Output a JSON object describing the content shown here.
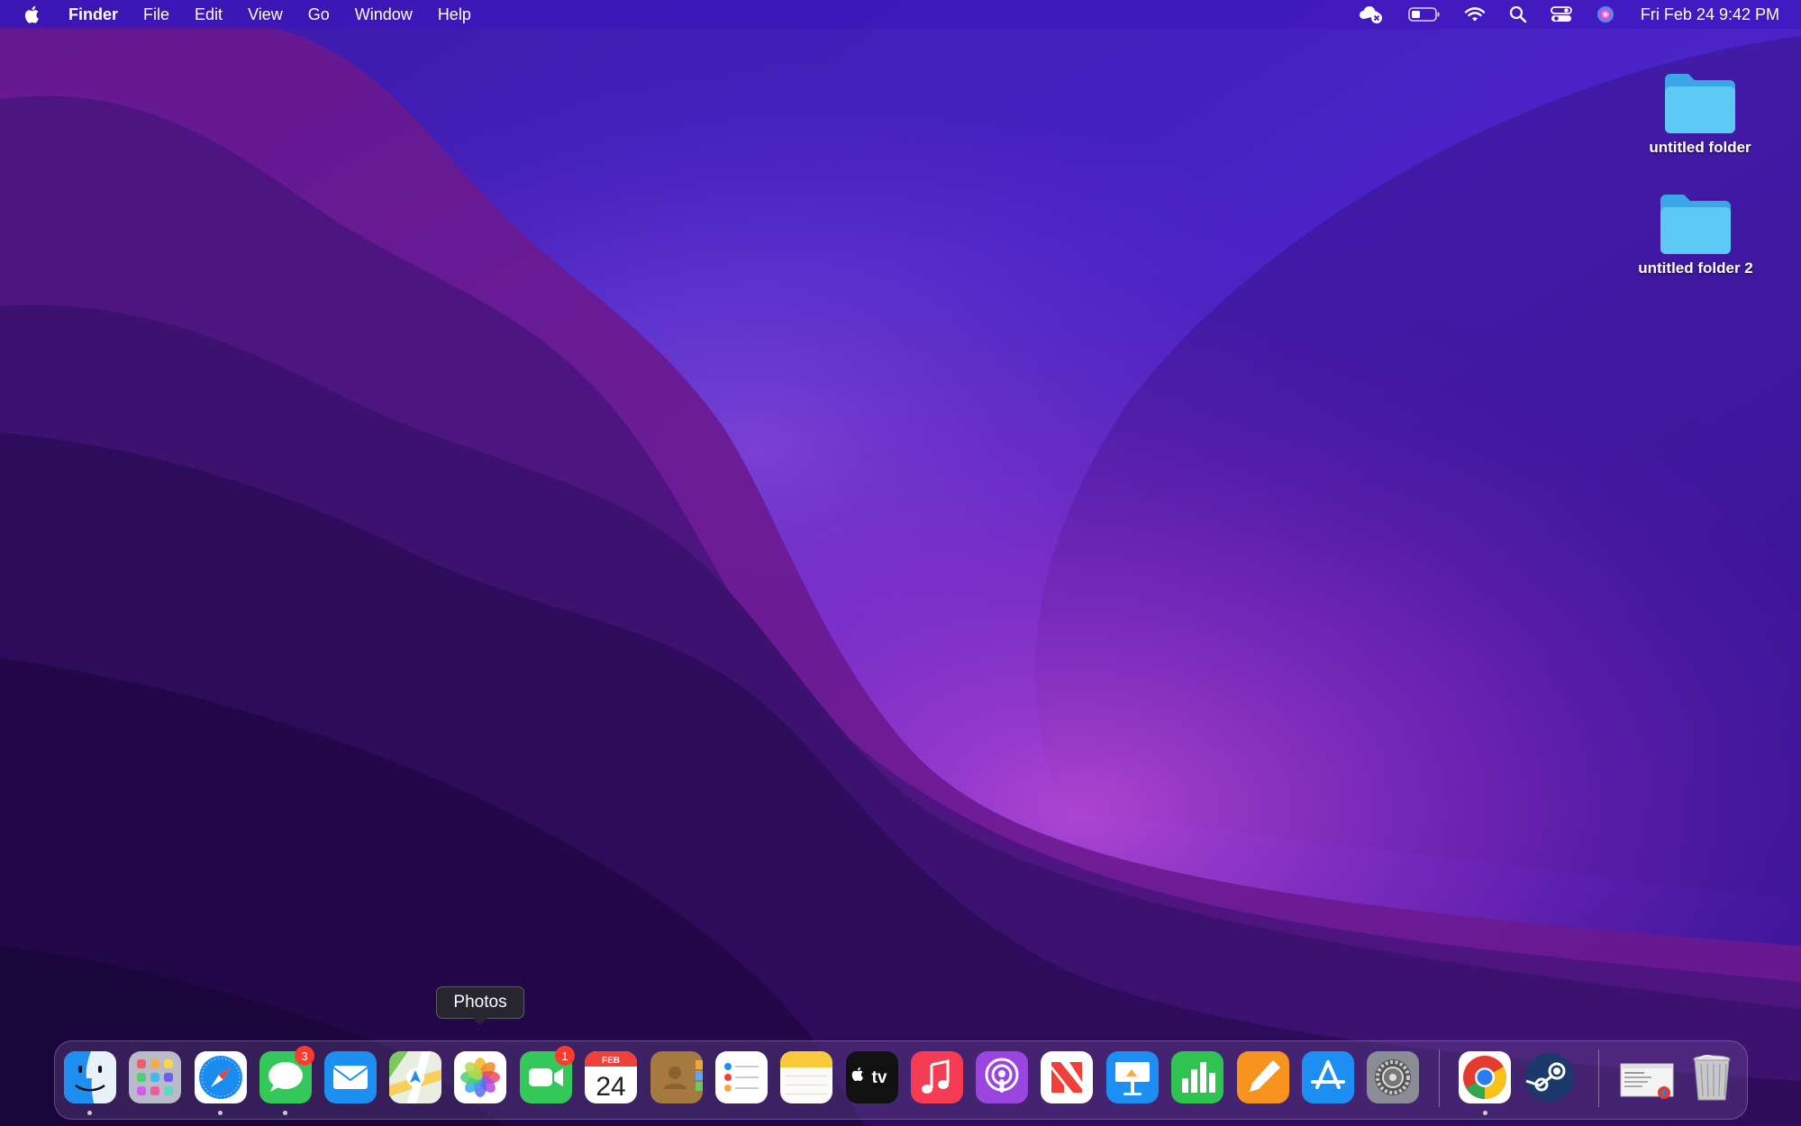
{
  "menubar": {
    "app_name": "Finder",
    "menus": [
      "File",
      "Edit",
      "View",
      "Go",
      "Window",
      "Help"
    ],
    "clock": "Fri Feb 24  9:42 PM",
    "status_icons": [
      "icloud-error-icon",
      "battery-icon",
      "wifi-icon",
      "spotlight-search-icon",
      "control-center-icon",
      "siri-icon"
    ]
  },
  "desktop": {
    "items": [
      {
        "label": "untitled folder"
      },
      {
        "label": "untitled folder 2"
      }
    ]
  },
  "tooltip": {
    "label": "Photos"
  },
  "dock": {
    "apps": [
      {
        "name": "Finder",
        "running": true
      },
      {
        "name": "Launchpad"
      },
      {
        "name": "Safari",
        "running": true
      },
      {
        "name": "Messages",
        "running": true,
        "badge": "3"
      },
      {
        "name": "Mail"
      },
      {
        "name": "Maps"
      },
      {
        "name": "Photos"
      },
      {
        "name": "FaceTime",
        "badge": "1"
      },
      {
        "name": "Calendar",
        "month": "FEB",
        "day": "24"
      },
      {
        "name": "Contacts"
      },
      {
        "name": "Reminders"
      },
      {
        "name": "Notes"
      },
      {
        "name": "TV",
        "glyph": "tv"
      },
      {
        "name": "Music"
      },
      {
        "name": "Podcasts"
      },
      {
        "name": "News"
      },
      {
        "name": "Keynote"
      },
      {
        "name": "Numbers"
      },
      {
        "name": "Pages"
      },
      {
        "name": "App Store"
      },
      {
        "name": "System Preferences"
      },
      {
        "name": "Google Chrome",
        "running": true
      },
      {
        "name": "Steam"
      },
      {
        "name": "Downloads stack"
      },
      {
        "name": "Trash"
      }
    ]
  },
  "colors": {
    "menubar": "#3c14be",
    "badge": "#ff3b30",
    "folder": "#5ec8f5"
  }
}
